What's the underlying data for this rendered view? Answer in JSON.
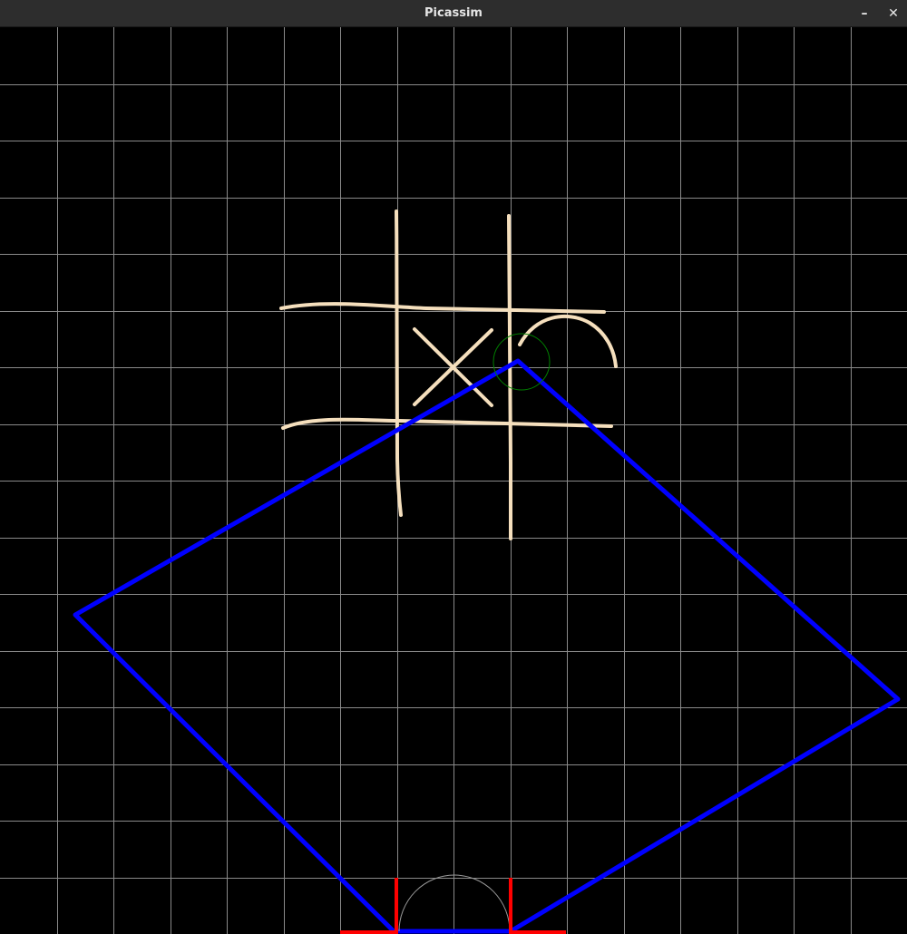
{
  "window": {
    "title": "Picassim",
    "minimize_glyph": "–",
    "close_glyph": "✕"
  },
  "canvas": {
    "background_color": "#000000",
    "grid_color": "#8a8a8a",
    "sketch_color": "#f5dfbd",
    "quad_color": "#0000ff",
    "cursor_color": "#008000",
    "marker_color": "#ff0000",
    "arc_color": "#9a9a9a"
  },
  "icons": {
    "minimize": "minimize-icon",
    "close": "close-icon"
  }
}
